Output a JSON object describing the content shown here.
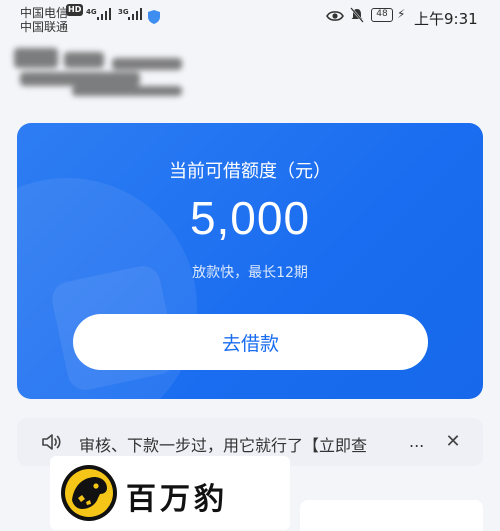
{
  "status_bar": {
    "carrier1": "中国电信",
    "carrier1_badge": "HD",
    "carrier2": "中国联通",
    "network1": "4G",
    "network2": "3G",
    "battery": "48",
    "time": "上午9:31"
  },
  "loan_card": {
    "title": "当前可借额度（元）",
    "amount": "5,000",
    "subtitle": "放款快，最长12期",
    "button_label": "去借款",
    "accent_color": "#1a6df0"
  },
  "notice": {
    "text": "审核、下款一步过，用它就行了【立即查",
    "ellipsis": "...",
    "close": "✕"
  },
  "watermark": {
    "text": "百万豹"
  },
  "icons": [
    "speaker-icon",
    "close-icon",
    "eye-icon",
    "bell-muted-icon",
    "shield-icon",
    "bolt-icon",
    "leopard-logo"
  ]
}
